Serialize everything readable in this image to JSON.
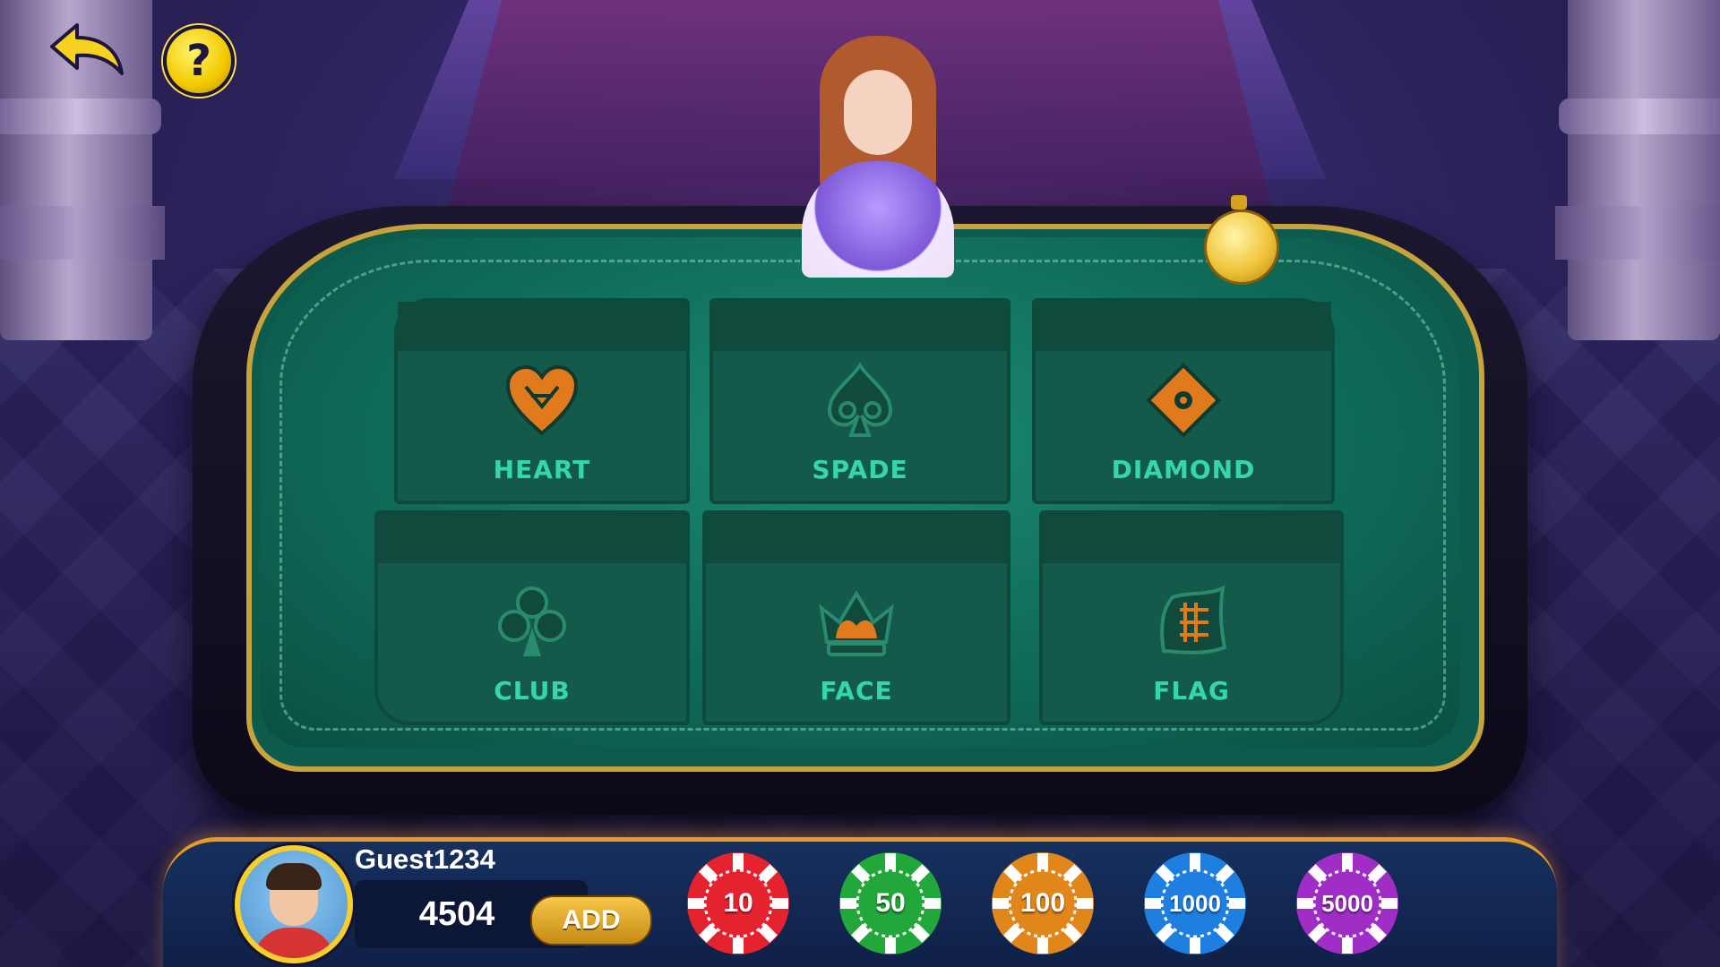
{
  "top_bar": {
    "help_label": "?"
  },
  "table": {
    "cells": [
      {
        "label": "HEART",
        "icon": "heart-icon"
      },
      {
        "label": "SPADE",
        "icon": "spade-icon"
      },
      {
        "label": "DIAMOND",
        "icon": "diamond-icon"
      },
      {
        "label": "CLUB",
        "icon": "club-icon"
      },
      {
        "label": "FACE",
        "icon": "crown-icon"
      },
      {
        "label": "FLAG",
        "icon": "flag-icon"
      }
    ]
  },
  "player": {
    "username": "Guest1234",
    "balance": "4504",
    "add_label": "ADD"
  },
  "chips": [
    {
      "value": "10",
      "color": "#e5232f"
    },
    {
      "value": "50",
      "color": "#22a83a"
    },
    {
      "value": "100",
      "color": "#e0861a"
    },
    {
      "value": "1000",
      "color": "#1f7fe0"
    },
    {
      "value": "5000",
      "color": "#a02ec6"
    }
  ],
  "colors": {
    "label_green": "#35d7a8",
    "icon_orange": "#e07a1c",
    "gold": "#c8a23a"
  }
}
